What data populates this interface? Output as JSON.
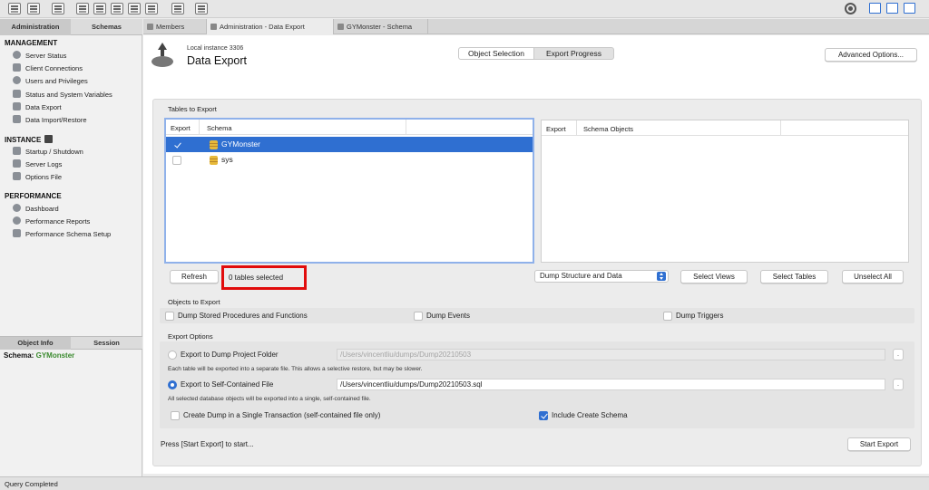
{
  "toolbar": {
    "icons": [
      "new-connection-icon",
      "sql-file-icon",
      "open-sql-icon",
      "manage-icon",
      "table-icon",
      "view-icon",
      "procedure-icon",
      "function-icon",
      "search-table-icon",
      "reconnect-icon"
    ],
    "right_icons": [
      "settings-icon",
      "toggle-sidebar-icon",
      "toggle-output-icon",
      "toggle-secondary-sidebar-icon"
    ]
  },
  "sidebar": {
    "tabs": [
      "Administration",
      "Schemas"
    ],
    "management_title": "MANAGEMENT",
    "management_items": [
      "Server Status",
      "Client Connections",
      "Users and Privileges",
      "Status and System Variables",
      "Data Export",
      "Data Import/Restore"
    ],
    "instance_title": "INSTANCE",
    "instance_items": [
      "Startup / Shutdown",
      "Server Logs",
      "Options File"
    ],
    "performance_title": "PERFORMANCE",
    "performance_items": [
      "Dashboard",
      "Performance Reports",
      "Performance Schema Setup"
    ],
    "info_tabs": [
      "Object Info",
      "Session"
    ],
    "schema_label": "Schema:",
    "schema_name": "GYMonster"
  },
  "main_tabs": [
    "Members",
    "Administration - Data Export",
    "GYMonster - Schema"
  ],
  "header": {
    "instance": "Local instance 3306",
    "title": "Data Export",
    "advanced_button": "Advanced Options..."
  },
  "segments": [
    "Object Selection",
    "Export Progress"
  ],
  "tables": {
    "label": "Tables to Export",
    "left_headers": [
      "Export",
      "Schema"
    ],
    "rows": [
      {
        "name": "GYMonster",
        "checked": true,
        "selected": true
      },
      {
        "name": "sys",
        "checked": false,
        "selected": false
      }
    ],
    "right_headers": [
      "Export",
      "Schema Objects"
    ],
    "refresh": "Refresh",
    "count": "0 tables selected",
    "dump_select": "Dump Structure and Data",
    "select_views": "Select Views",
    "select_tables": "Select Tables",
    "unselect_all": "Unselect All"
  },
  "objects": {
    "label": "Objects to Export",
    "items": [
      "Dump Stored Procedures and Functions",
      "Dump Events",
      "Dump Triggers"
    ]
  },
  "options": {
    "label": "Export Options",
    "folder_label": "Export to Dump Project Folder",
    "folder_path": "/Users/vincentliu/dumps/Dump20210503",
    "folder_note": "Each table will be exported into a separate file. This allows a selective restore, but may be slower.",
    "file_label": "Export to Self-Contained File",
    "file_path": "/Users/vincentliu/dumps/Dump20210503.sql",
    "file_note": "All selected database objects will be exported into a single, self-contained file.",
    "browse": ".",
    "single_txn": "Create Dump in a Single Transaction (self-contained file only)",
    "include_schema": "Include Create Schema"
  },
  "footer": {
    "hint": "Press [Start Export] to start...",
    "start": "Start Export"
  },
  "status": "Query Completed",
  "colors": {
    "accent": "#2f6fd1",
    "highlight_border": "#e10c0c",
    "schema_name": "#3a8a2e"
  }
}
